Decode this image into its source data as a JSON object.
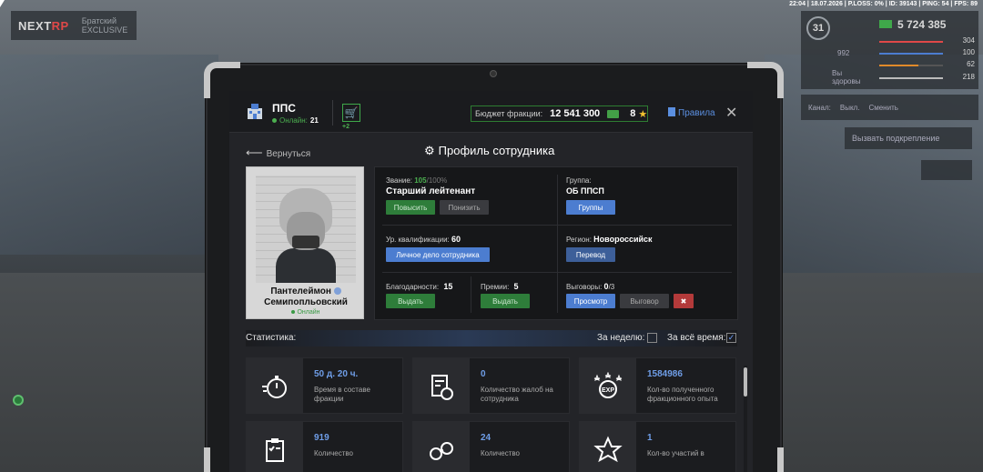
{
  "hud": {
    "status_line": "22:04 | 18.07.2026 | P.LOSS: 0% | ID: 39143 | PING: 54 | FPS: 89",
    "logo_text_a": "NEXT",
    "logo_text_b": "RP",
    "server_line1": "Братский",
    "server_line2": "EXCLUSIVE",
    "level": "31",
    "money": "5 724 385",
    "stat_health": "304",
    "stat_armor": "100",
    "stat_hunger": "62",
    "stat_fuel": "218",
    "side_value": "992",
    "side_label": "Вы здоровы",
    "voice_label": "Канал:",
    "voice_value": "Выкл.",
    "voice_hint": "Сменить",
    "backup_label": "Вызвать подкрепление"
  },
  "header": {
    "faction": "ППС",
    "online_label": "Онлайн:",
    "online_count": "21",
    "cart_badge": "+2",
    "budget_label": "Бюджет фракции:",
    "budget_value": "12 541 300",
    "points": "8",
    "rules": "Правила",
    "close": "✕"
  },
  "nav": {
    "back": "Вернуться",
    "title": "Профиль сотрудника"
  },
  "profile": {
    "first_name": "Пантелеймон",
    "last_name": "Семипопльовский",
    "online": "Онлайн"
  },
  "info": {
    "rank_label": "Звание:",
    "rank_points": "105",
    "rank_max": "/100%",
    "rank_name": "Старший лейтенант",
    "btn_promote": "Повысить",
    "btn_demote": "Понизить",
    "group_label": "Группа:",
    "group_value": "ОБ ППСП",
    "btn_groups": "Группы",
    "qual_label": "Ур. квалификации:",
    "qual_value": "60",
    "btn_dossier": "Личное дело сотрудника",
    "region_label": "Регион:",
    "region_value": "Новороссийск",
    "btn_transfer": "Перевод",
    "thanks_label": "Благодарности:",
    "thanks_value": "15",
    "btn_give_thanks": "Выдать",
    "bonus_label": "Премии:",
    "bonus_value": "5",
    "btn_give_bonus": "Выдать",
    "reprimand_label": "Выговоры:",
    "reprimand_value": "0",
    "reprimand_max": "/3",
    "btn_view": "Просмотр",
    "btn_reprimand": "Выговор"
  },
  "stats": {
    "label": "Статистика:",
    "week": "За неделю:",
    "all_time": "За всё время:",
    "all_time_checked": "✓",
    "cards": [
      {
        "value": "50 д. 20 ч.",
        "desc": "Время в составе фракции",
        "icon": "stopwatch-icon"
      },
      {
        "value": "0",
        "desc": "Количество жалоб на сотрудника",
        "icon": "complaint-icon"
      },
      {
        "value": "1584986",
        "desc": "Кол-во полученного фракционного опыта",
        "icon": "exp-icon"
      },
      {
        "value": "919",
        "desc": "Количество",
        "icon": "clipboard-icon"
      },
      {
        "value": "24",
        "desc": "Количество",
        "icon": "handcuffs-icon"
      },
      {
        "value": "1",
        "desc": "Кол-во участий в",
        "icon": "star-icon"
      }
    ]
  }
}
